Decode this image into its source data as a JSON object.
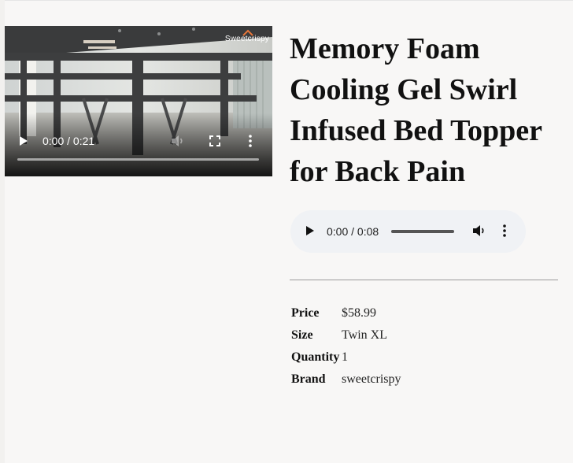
{
  "video": {
    "watermark": "Sweetcrispy",
    "time": "0:00 / 0:21",
    "progress": 0
  },
  "product": {
    "title": "Memory Foam Cooling Gel Swirl Infused Bed Topper for Back Pain"
  },
  "audio": {
    "time": "0:00 / 0:08",
    "progress": 0
  },
  "specs": [
    {
      "label": "Price",
      "value": "$58.99"
    },
    {
      "label": "Size",
      "value": "Twin XL"
    },
    {
      "label": "Quantity",
      "value": "1"
    },
    {
      "label": "Brand",
      "value": "sweetcrispy"
    }
  ],
  "icons": {
    "play": "play-icon",
    "volume": "volume-icon",
    "fullscreen": "fullscreen-icon",
    "more": "more-vertical-icon"
  }
}
